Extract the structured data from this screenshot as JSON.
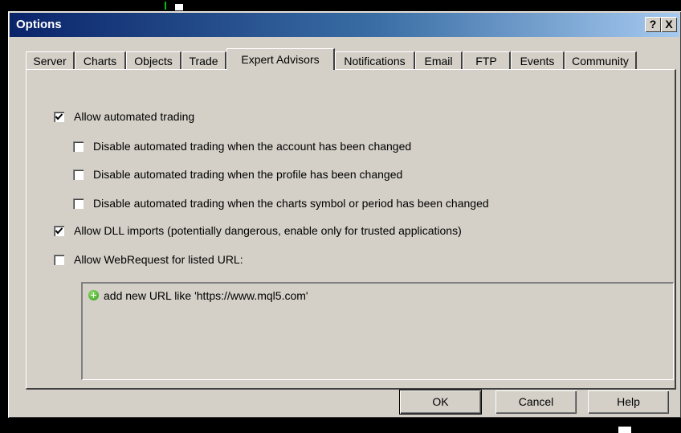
{
  "window": {
    "title": "Options",
    "help_button": "?",
    "close_button": "X"
  },
  "tabs": [
    {
      "label": "Server",
      "active": false
    },
    {
      "label": "Charts",
      "active": false
    },
    {
      "label": "Objects",
      "active": false
    },
    {
      "label": "Trade",
      "active": false
    },
    {
      "label": "Expert Advisors",
      "active": true
    },
    {
      "label": "Notifications",
      "active": false
    },
    {
      "label": "Email",
      "active": false
    },
    {
      "label": "FTP",
      "active": false
    },
    {
      "label": "Events",
      "active": false
    },
    {
      "label": "Community",
      "active": false
    }
  ],
  "options": {
    "allow_automated_trading": {
      "label": "Allow automated trading",
      "checked": true
    },
    "disable_on_account_change": {
      "label": "Disable automated trading when the account has been changed",
      "checked": false
    },
    "disable_on_profile_change": {
      "label": "Disable automated trading when the profile has been changed",
      "checked": false
    },
    "disable_on_symbol_change": {
      "label": "Disable automated trading when the charts symbol or period has been changed",
      "checked": false
    },
    "allow_dll_imports": {
      "label": "Allow DLL imports (potentially dangerous, enable only for trusted applications)",
      "checked": true
    },
    "allow_webrequest": {
      "label": "Allow WebRequest for listed URL:",
      "checked": false
    }
  },
  "url_list": {
    "add_item": "add new URL like 'https://www.mql5.com'",
    "add_icon": "plus-circle-icon"
  },
  "buttons": {
    "ok": "OK",
    "cancel": "Cancel",
    "help": "Help"
  }
}
